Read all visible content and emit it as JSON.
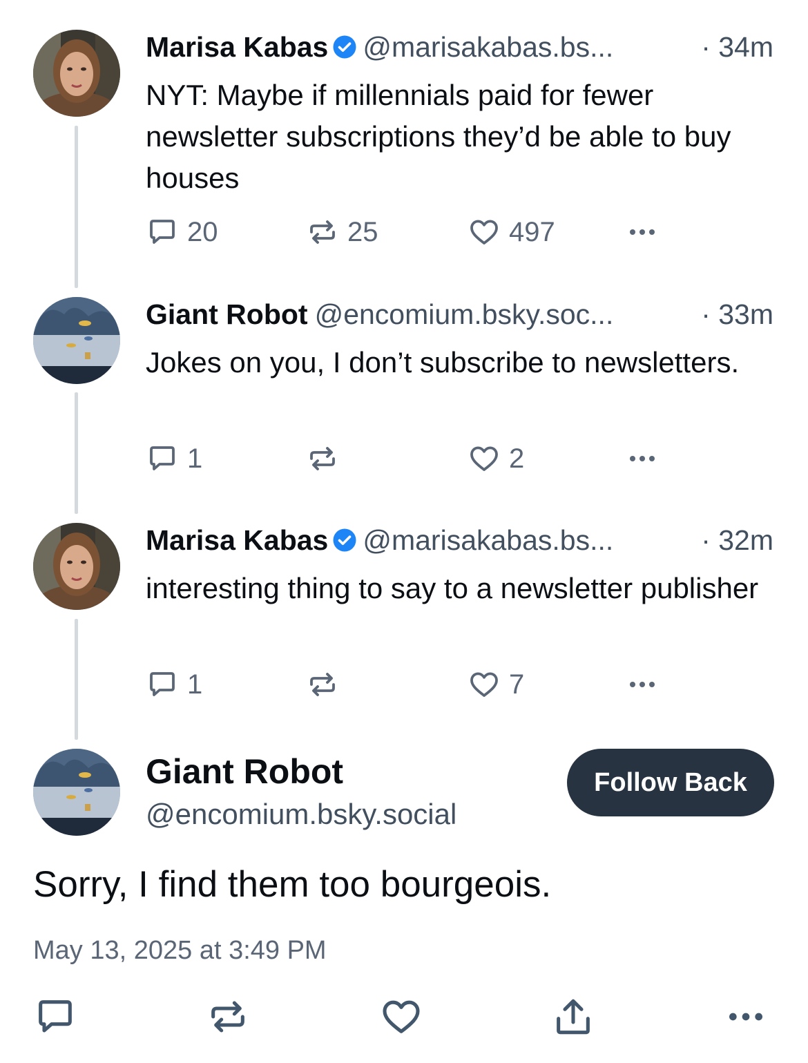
{
  "posts": [
    {
      "author": "Marisa Kabas",
      "verified": true,
      "handle": "@marisakabas.bs...",
      "time": "· 34m",
      "text": "NYT: Maybe if millennials paid for fewer newsletter subscriptions they’d be able to buy houses",
      "replies": "20",
      "reposts": "25",
      "likes": "497"
    },
    {
      "author": "Giant Robot",
      "verified": false,
      "handle": "@encomium.bsky.soc...",
      "time": "· 33m",
      "text": "Jokes on you, I don’t subscribe to newsletters.",
      "replies": "1",
      "reposts": "",
      "likes": "2"
    },
    {
      "author": "Marisa Kabas",
      "verified": true,
      "handle": "@marisakabas.bs...",
      "time": "· 32m",
      "text": "interesting thing to say to a newsletter publisher",
      "replies": "1",
      "reposts": "",
      "likes": "7"
    }
  ],
  "main_post": {
    "author": "Giant Robot",
    "handle": "@encomium.bsky.social",
    "follow_label": "Follow Back",
    "text": "Sorry, I find them too bourgeois.",
    "timestamp": "May 13, 2025 at 3:49 PM"
  },
  "icons": {
    "reply": "speech-bubble-icon",
    "repost": "repost-arrows-icon",
    "like": "heart-icon",
    "more": "ellipsis-icon",
    "share": "share-upload-icon",
    "verified": "verified-check-icon"
  },
  "colors": {
    "verified": "#1d85f5",
    "follow_button": "#283341",
    "muted_text": "#424f5e",
    "thread_line": "#d4d9de"
  }
}
